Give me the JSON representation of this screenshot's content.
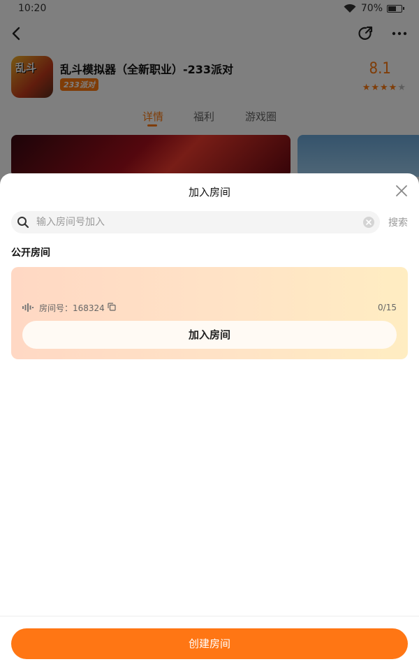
{
  "status_bar": {
    "time": "10:20",
    "battery": "70%"
  },
  "game": {
    "logo_text": "乱斗",
    "title": "乱斗模拟器（全新职业）-233派对",
    "tag": "233派对",
    "rating": "8.1",
    "stars": "4 of 5",
    "star_full": "★★★★",
    "star_empty": "★"
  },
  "tabs": [
    {
      "label": "详情",
      "active": true
    },
    {
      "label": "福利",
      "active": false
    },
    {
      "label": "游戏圈",
      "active": false
    }
  ],
  "sheet": {
    "title": "加入房间",
    "search": {
      "placeholder": "输入房间号加入",
      "value": "",
      "button": "搜索"
    },
    "section_label": "公开房间",
    "rooms": [
      {
        "number": "房间号：168324",
        "capacity": "0/15",
        "join_label": "加入房间"
      }
    ],
    "create_label": "创建房间"
  },
  "colors": {
    "accent": "#ff7614",
    "overlay": "rgba(0,0,0,0.5)"
  }
}
